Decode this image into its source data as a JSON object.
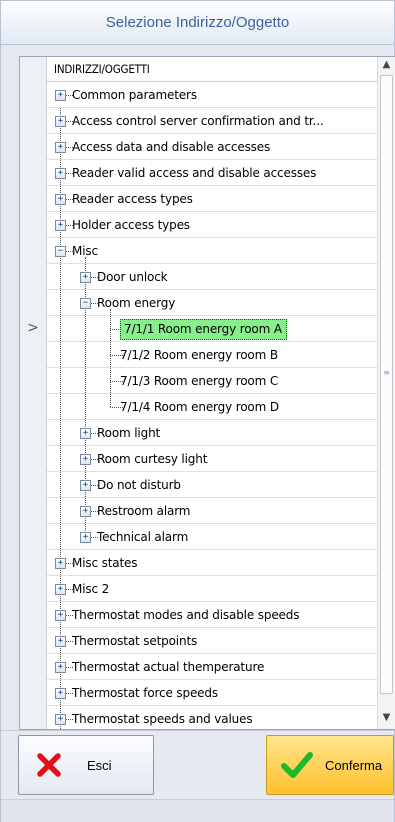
{
  "window": {
    "title": "Selezione Indirizzo/Oggetto"
  },
  "grid": {
    "column_header": "INDIRIZZI/OGGETTI",
    "nodes": [
      {
        "label": "Common parameters",
        "level": 0,
        "state": "collapsed"
      },
      {
        "label": "Access control server confirmation and tr...",
        "level": 0,
        "state": "collapsed"
      },
      {
        "label": "Access data and disable accesses",
        "level": 0,
        "state": "collapsed"
      },
      {
        "label": "Reader valid access and disable accesses",
        "level": 0,
        "state": "collapsed"
      },
      {
        "label": "Reader access types",
        "level": 0,
        "state": "collapsed"
      },
      {
        "label": "Holder access types",
        "level": 0,
        "state": "collapsed"
      },
      {
        "label": "Misc",
        "level": 0,
        "state": "expanded"
      },
      {
        "label": "Door unlock",
        "level": 1,
        "state": "collapsed"
      },
      {
        "label": "Room energy",
        "level": 1,
        "state": "expanded"
      },
      {
        "label": "7/1/1 Room energy room A",
        "level": 2,
        "state": "leaf",
        "selected": true
      },
      {
        "label": "7/1/2 Room energy room B",
        "level": 2,
        "state": "leaf"
      },
      {
        "label": "7/1/3 Room energy room C",
        "level": 2,
        "state": "leaf"
      },
      {
        "label": "7/1/4 Room energy room D",
        "level": 2,
        "state": "leaf",
        "last": true
      },
      {
        "label": "Room light",
        "level": 1,
        "state": "collapsed"
      },
      {
        "label": "Room curtesy light",
        "level": 1,
        "state": "collapsed"
      },
      {
        "label": "Do not disturb",
        "level": 1,
        "state": "collapsed"
      },
      {
        "label": "Restroom alarm",
        "level": 1,
        "state": "collapsed"
      },
      {
        "label": "Technical alarm",
        "level": 1,
        "state": "collapsed",
        "last": true
      },
      {
        "label": "Misc states",
        "level": 0,
        "state": "collapsed"
      },
      {
        "label": "Misc 2",
        "level": 0,
        "state": "collapsed"
      },
      {
        "label": "Thermostat modes and disable speeds",
        "level": 0,
        "state": "collapsed"
      },
      {
        "label": "Thermostat setpoints",
        "level": 0,
        "state": "collapsed"
      },
      {
        "label": "Thermostat actual themperature",
        "level": 0,
        "state": "collapsed"
      },
      {
        "label": "Thermostat force speeds",
        "level": 0,
        "state": "collapsed"
      },
      {
        "label": "Thermostat speeds and values",
        "level": 0,
        "state": "collapsed"
      }
    ],
    "current_row_indicator": ">"
  },
  "buttons": {
    "cancel_label": "Esci",
    "confirm_label": "Conferma"
  },
  "colors": {
    "title_text": "#3c63a0",
    "selection": "#86f08a",
    "confirm_button": "#ffc12d",
    "cancel_icon": "#e0101a",
    "confirm_icon": "#1fb82a"
  },
  "icons": {
    "cancel": "red-x-icon",
    "confirm": "green-check-icon",
    "expand": "plus-box-icon",
    "collapse": "minus-box-icon"
  }
}
